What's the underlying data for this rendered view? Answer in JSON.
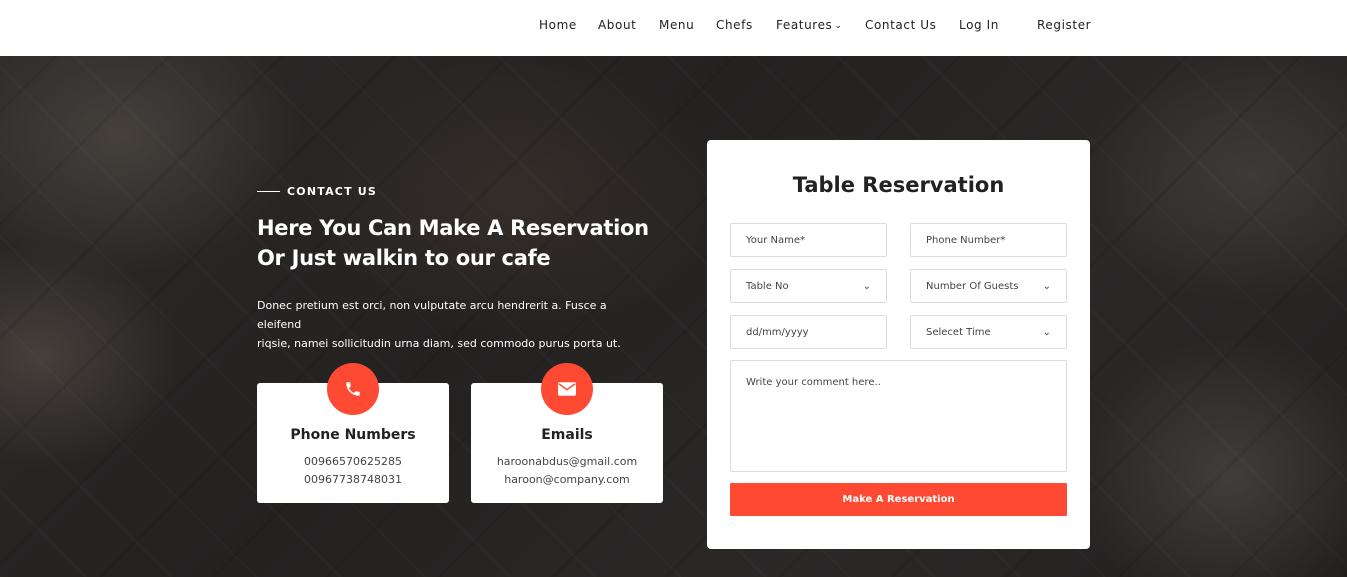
{
  "nav": {
    "items": [
      "Home",
      "About",
      "Menu",
      "Chefs",
      "Features",
      "Contact Us",
      "Log In",
      "Register"
    ]
  },
  "hero": {
    "eyebrow": "CONTACT US",
    "title_line1": "Here You Can Make A Reservation",
    "title_line2": "Or Just walkin to our cafe",
    "desc_line1": "Donec pretium est orci, non vulputate arcu hendrerit a. Fusce a eleifend",
    "desc_line2": "riqsie, namei sollicitudin urna diam, sed commodo purus porta ut."
  },
  "cards": {
    "phone": {
      "title": "Phone Numbers",
      "line1": "00966570625285",
      "line2": "00967738748031",
      "icon": "phone-icon"
    },
    "email": {
      "title": "Emails",
      "line1": "haroonabdus@gmail.com",
      "line2": "haroon@company.com",
      "icon": "envelope-icon"
    }
  },
  "form": {
    "title": "Table Reservation",
    "name_placeholder": "Your Name*",
    "phone_placeholder": "Phone Number*",
    "table_select": "Table No",
    "guests_select": "Number Of Guests",
    "date_placeholder": "dd/mm/yyyy",
    "time_select": "Selecet Time",
    "comment_placeholder": "Write your comment here..",
    "submit_label": "Make A Reservation"
  },
  "colors": {
    "accent": "#fe4a33",
    "header_bg": "#ffffff",
    "hero_overlay": "#2a2827"
  }
}
